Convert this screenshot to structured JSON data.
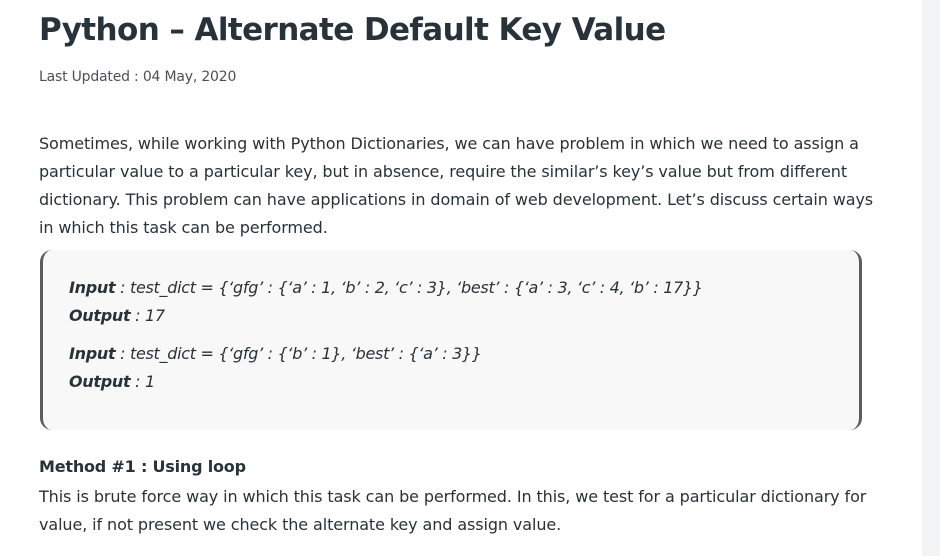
{
  "article": {
    "title": "Python – Alternate Default Key Value",
    "last_updated_label": "Last Updated : ",
    "last_updated_date": "04 May, 2020",
    "intro": "Sometimes, while working with Python Dictionaries, we can have problem in which we need to assign a particular value to a particular key, but in absence, require the similar’s key’s value but from different dictionary. This problem can have applications in domain of web development. Let’s discuss certain ways in which this task can be performed.",
    "examples": [
      {
        "input_label": "Input",
        "input_value": " : test_dict = {‘gfg’ : {‘a’ : 1, ‘b’ : 2, ‘c’ : 3}, ‘best’ : {‘a’ : 3, ‘c’ : 4, ‘b’ : 17}}",
        "output_label": "Output",
        "output_value": " : 17"
      },
      {
        "input_label": "Input",
        "input_value": " : test_dict = {‘gfg’ : {‘b’ : 1}, ‘best’ : {‘a’ : 3}}",
        "output_label": "Output",
        "output_value": " : 1"
      }
    ],
    "method1_heading": "Method #1 : Using loop",
    "method1_text": "This is brute force way in which this task can be performed. In this, we test for a particular dictionary for value, if not present we check the alternate key and assign value."
  },
  "colors": {
    "text": "#273239",
    "box_background": "#f8f8f8",
    "box_border": "#5c5c5c",
    "scroll_gutter": "#f3f4f5"
  }
}
